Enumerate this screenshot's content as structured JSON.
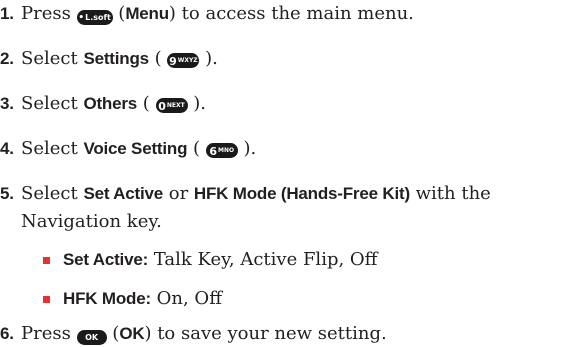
{
  "steps": [
    {
      "number": "1.",
      "text_before": "Press ",
      "key_label": "L.soft",
      "bold": "Menu",
      "text_after": " to access the main menu."
    },
    {
      "number": "2.",
      "text_before": "Select ",
      "bold": "Settings",
      "key_main": "9",
      "key_sup": "WXYZ",
      "text_after": " )."
    },
    {
      "number": "3.",
      "text_before": "Select ",
      "bold": "Others",
      "key_main": "0",
      "key_sup": "NEXT",
      "text_after": " )."
    },
    {
      "number": "4.",
      "text_before": "Select ",
      "bold": "Voice Setting",
      "key_main": "6",
      "key_sup": "MNO",
      "text_after": " )."
    },
    {
      "number": "5.",
      "text_before": "Select ",
      "bold1": "Set Active",
      "text_mid": " or ",
      "bold2": "HFK Mode (Hands-Free Kit)",
      "text_after": " with the",
      "continuation": "Navigation key.",
      "options": [
        {
          "bold": "Set Active:",
          "text": " Talk Key, Active Flip, Off"
        },
        {
          "bold": "HFK Mode:",
          "text": " On, Off"
        }
      ]
    },
    {
      "number": "6.",
      "text_before": "Press ",
      "key_label": "OK",
      "bold": "OK",
      "text_after": " to save your new setting."
    }
  ],
  "colors": {
    "text": "#231f20",
    "bullet": "#e8322f",
    "key": "#1a1a1a"
  }
}
